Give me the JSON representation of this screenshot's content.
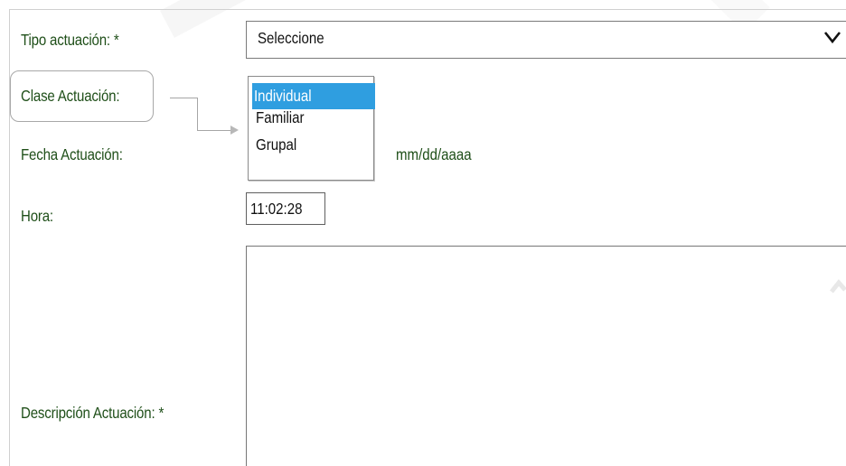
{
  "form": {
    "tipo_label": "Tipo actuación: *",
    "clase_label": "Clase Actuación:",
    "fecha_label": "Fecha Actuación:",
    "hora_label": "Hora:",
    "descripcion_label": "Descripción Actuación: *",
    "tipo_select": {
      "selected": "Seleccione",
      "icon": "chevron-down-icon"
    },
    "clase_listbox": {
      "options": [
        "Individual",
        "Familiar",
        "Grupal"
      ],
      "selected": "Individual"
    },
    "fecha_hint": "mm/dd/aaaa",
    "hora_value": "11:02:28",
    "descripcion_value": ""
  },
  "colors": {
    "label_text": "#1f4f19",
    "selected_option_bg": "#2f9ee0",
    "selected_option_text": "#ffffff",
    "border": "#777777"
  }
}
